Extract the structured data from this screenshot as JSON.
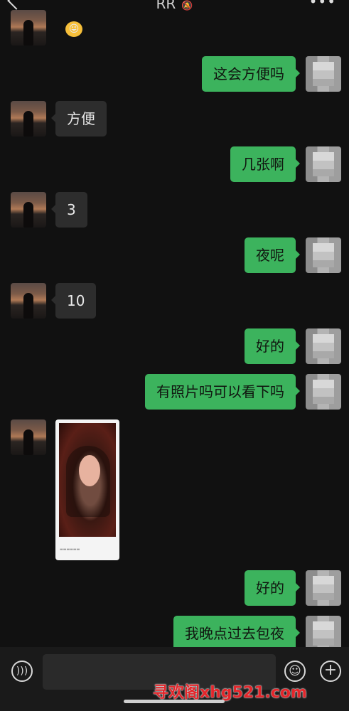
{
  "header": {
    "title": "RR",
    "mute_icon": "bell-mute-icon",
    "more_icon": "more-dots-icon"
  },
  "messages": [
    {
      "side": "left",
      "type": "emoji",
      "text": "😜"
    },
    {
      "side": "right",
      "text": "这会方便吗"
    },
    {
      "side": "left",
      "text": "方便"
    },
    {
      "side": "right",
      "text": "几张啊"
    },
    {
      "side": "left",
      "text": "3"
    },
    {
      "side": "right",
      "text": "夜呢"
    },
    {
      "side": "left",
      "text": "10"
    },
    {
      "side": "right",
      "text": "好的"
    },
    {
      "side": "right",
      "text": "有照片吗可以看下吗"
    },
    {
      "side": "left",
      "type": "image"
    },
    {
      "side": "right",
      "text": "好的"
    },
    {
      "side": "right",
      "text": "我晚点过去包夜"
    }
  ],
  "input_bar": {
    "voice_icon": "voice-icon",
    "emoji_icon": "emoji-icon",
    "plus_icon": "plus-icon"
  },
  "watermark": "寻欢阁xhg521.com",
  "colors": {
    "bubble_self": "#3cb35d",
    "bubble_other": "#2d2d2d",
    "background": "#111111"
  }
}
